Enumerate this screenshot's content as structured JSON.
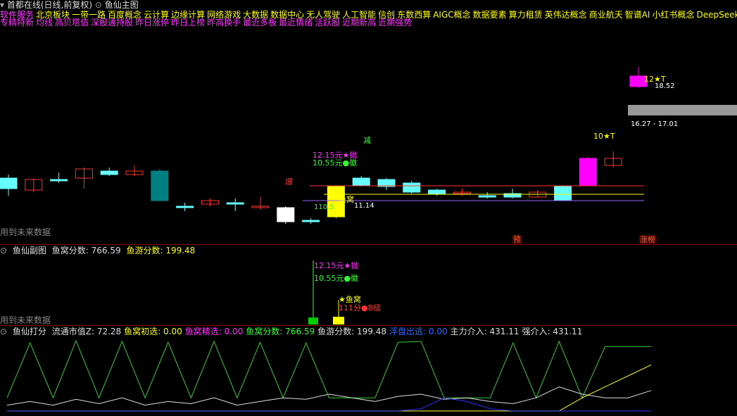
{
  "title_bar": {
    "stock": "首都在线(日线,前复权)",
    "indicator": "鱼仙主图"
  },
  "concepts": [
    "软件服务",
    "北京板块",
    "一带一路",
    "百度概念",
    "云计算",
    "边缘计算",
    "网络游戏",
    "大数据",
    "数据中心",
    "无人驾驶",
    "人工智能",
    "信创",
    "东数西算",
    "AIGC概念",
    "数据要素",
    "算力租赁",
    "英伟达概念",
    "商业航天",
    "智谱AI",
    "小红书概念",
    "DeepSeek"
  ],
  "signals": [
    "专精特新",
    "均线",
    "高贝塔值",
    "深股通持股",
    "昨日涨停",
    "昨日上榜",
    "昨高换手",
    "最近多板",
    "最近情绪",
    "活跃股",
    "近期新高",
    "近期强势"
  ],
  "main_chart": {
    "future_data": "用到未来数据",
    "annotations": {
      "pink_star": "12.15元★抛",
      "green_dot": "10.55元●徽",
      "jian": "减",
      "yuwo": "鱼窝",
      "low_range_left": "110.5",
      "low_range_right": "11.14",
      "tag_t12": "12★T",
      "tag_t10": "10★T",
      "price_high": "18.52",
      "price_range": "16.27 - 17.01",
      "tag_yu": "预",
      "tag_zhangbang": "涨榜",
      "tag_bao": "爆"
    },
    "candles": [
      {
        "o": 10.4,
        "c": 11.0,
        "h": 11.2,
        "l": 10.0,
        "t": "up"
      },
      {
        "o": 10.9,
        "c": 10.3,
        "h": 11.0,
        "l": 10.2,
        "t": "down"
      },
      {
        "o": 10.8,
        "c": 10.9,
        "h": 11.3,
        "l": 10.7,
        "t": "up"
      },
      {
        "o": 11.5,
        "c": 11.0,
        "h": 11.6,
        "l": 10.4,
        "t": "down"
      },
      {
        "o": 11.2,
        "c": 11.4,
        "h": 11.6,
        "l": 11.1,
        "t": "up"
      },
      {
        "o": 11.4,
        "c": 11.2,
        "h": 11.7,
        "l": 11.1,
        "t": "down"
      },
      {
        "o": 11.4,
        "c": 9.7,
        "h": 11.5,
        "l": 9.7,
        "t": "cyan"
      },
      {
        "o": 9.4,
        "c": 9.3,
        "h": 9.6,
        "l": 9.1,
        "t": "up"
      },
      {
        "o": 9.5,
        "c": 9.7,
        "h": 9.8,
        "l": 9.4,
        "t": "down"
      },
      {
        "o": 9.6,
        "c": 9.5,
        "h": 9.8,
        "l": 9.1,
        "t": "up"
      },
      {
        "o": 9.4,
        "c": 9.3,
        "h": 9.9,
        "l": 9.2,
        "t": "down"
      },
      {
        "o": 9.3,
        "c": 8.5,
        "h": 9.4,
        "l": 8.4,
        "t": "white"
      },
      {
        "o": 8.6,
        "c": 8.5,
        "h": 8.7,
        "l": 8.4,
        "t": "up"
      },
      {
        "o": 8.8,
        "c": 10.5,
        "h": 10.6,
        "l": 8.7,
        "t": "yellow"
      },
      {
        "o": 10.6,
        "c": 11.0,
        "h": 11.1,
        "l": 10.5,
        "t": "up"
      },
      {
        "o": 10.9,
        "c": 10.5,
        "h": 11.0,
        "l": 10.3,
        "t": "up"
      },
      {
        "o": 10.7,
        "c": 10.2,
        "h": 10.8,
        "l": 10.1,
        "t": "up"
      },
      {
        "o": 10.1,
        "c": 10.3,
        "h": 10.4,
        "l": 10.0,
        "t": "up"
      },
      {
        "o": 10.2,
        "c": 10.1,
        "h": 10.4,
        "l": 10.0,
        "t": "down"
      },
      {
        "o": 9.9,
        "c": 10.0,
        "h": 10.2,
        "l": 9.8,
        "t": "up"
      },
      {
        "o": 9.9,
        "c": 10.1,
        "h": 10.4,
        "l": 9.8,
        "t": "up"
      },
      {
        "o": 10.2,
        "c": 9.9,
        "h": 10.3,
        "l": 9.9,
        "t": "down"
      },
      {
        "o": 9.7,
        "c": 10.5,
        "h": 10.6,
        "l": 9.7,
        "t": "up"
      },
      {
        "o": 10.6,
        "c": 12.1,
        "h": 12.2,
        "l": 10.6,
        "t": "magenta"
      },
      {
        "o": 11.7,
        "c": 12.1,
        "h": 12.5,
        "l": 11.6,
        "t": "down"
      },
      {
        "o": 16.2,
        "c": 16.8,
        "h": 17.3,
        "l": 16.1,
        "t": "magenta"
      }
    ]
  },
  "sub_chart": {
    "name": "鱼仙副图",
    "yuwo_label": "鱼窝分数:",
    "yuwo_value": "766.59",
    "yuyou_label": "鱼游分数:",
    "yuyou_value": "199.48",
    "future_data": "用到未来数据",
    "pink_star": "12.15元★抛",
    "green_dot": "10.55元●徽",
    "star_yuwo": "★鱼窝",
    "b_level": "111分●B级"
  },
  "score_panel": {
    "name": "鱼仙打分",
    "items": [
      {
        "label": "流通市值Z:",
        "value": "72.28",
        "color": "#dddddd"
      },
      {
        "label": "鱼窝初选:",
        "value": "0.00",
        "color": "#ffff00"
      },
      {
        "label": "鱼窝精选:",
        "value": "0.00",
        "color": "#ff33ff"
      },
      {
        "label": "鱼窝分数:",
        "value": "766.59",
        "color": "#33ff33"
      },
      {
        "label": "鱼游分数:",
        "value": "199.48",
        "color": "#dddddd"
      },
      {
        "label": "浮盘出逃:",
        "value": "0.00",
        "color": "#3366ff"
      },
      {
        "label": "主力介入:",
        "value": "431.11",
        "color": "#dddddd"
      },
      {
        "label": "强介入:",
        "value": "431.11",
        "color": "#dddddd"
      }
    ],
    "green_series": [
      0.2,
      0.95,
      0.2,
      0.98,
      0.2,
      0.97,
      0.2,
      0.96,
      0.2,
      0.97,
      0.2,
      0.96,
      0.2,
      0.95,
      0.2,
      0.2,
      0.2,
      0.96,
      0.97,
      0.2,
      0.2,
      0.2,
      0.95,
      0.2,
      0.97,
      0.2,
      0.9,
      0.9,
      0.9
    ],
    "white_series": [
      0.1,
      0.15,
      0.1,
      0.18,
      0.12,
      0.2,
      0.1,
      0.15,
      0.12,
      0.2,
      0.1,
      0.15,
      0.2,
      0.18,
      0.25,
      0.2,
      0.15,
      0.22,
      0.25,
      0.18,
      0.2,
      0.15,
      0.12,
      0.2,
      0.35,
      0.25,
      0.2,
      0.2,
      0.3
    ],
    "yellow_series": [
      0.02,
      0.02,
      0.02,
      0.02,
      0.02,
      0.02,
      0.02,
      0.02,
      0.02,
      0.02,
      0.02,
      0.02,
      0.02,
      0.02,
      0.02,
      0.02,
      0.02,
      0.02,
      0.02,
      0.02,
      0.02,
      0.02,
      0.02,
      0.02,
      0.02,
      0.2,
      0.35,
      0.5,
      0.65
    ],
    "blue_series": [
      0.02,
      0.02,
      0.02,
      0.02,
      0.02,
      0.02,
      0.02,
      0.02,
      0.02,
      0.02,
      0.02,
      0.02,
      0.02,
      0.02,
      0.02,
      0.02,
      0.02,
      0.02,
      0.05,
      0.2,
      0.15,
      0.05,
      0.02,
      0.02,
      0.02,
      0.02,
      0.02,
      0.02,
      0.02
    ]
  }
}
